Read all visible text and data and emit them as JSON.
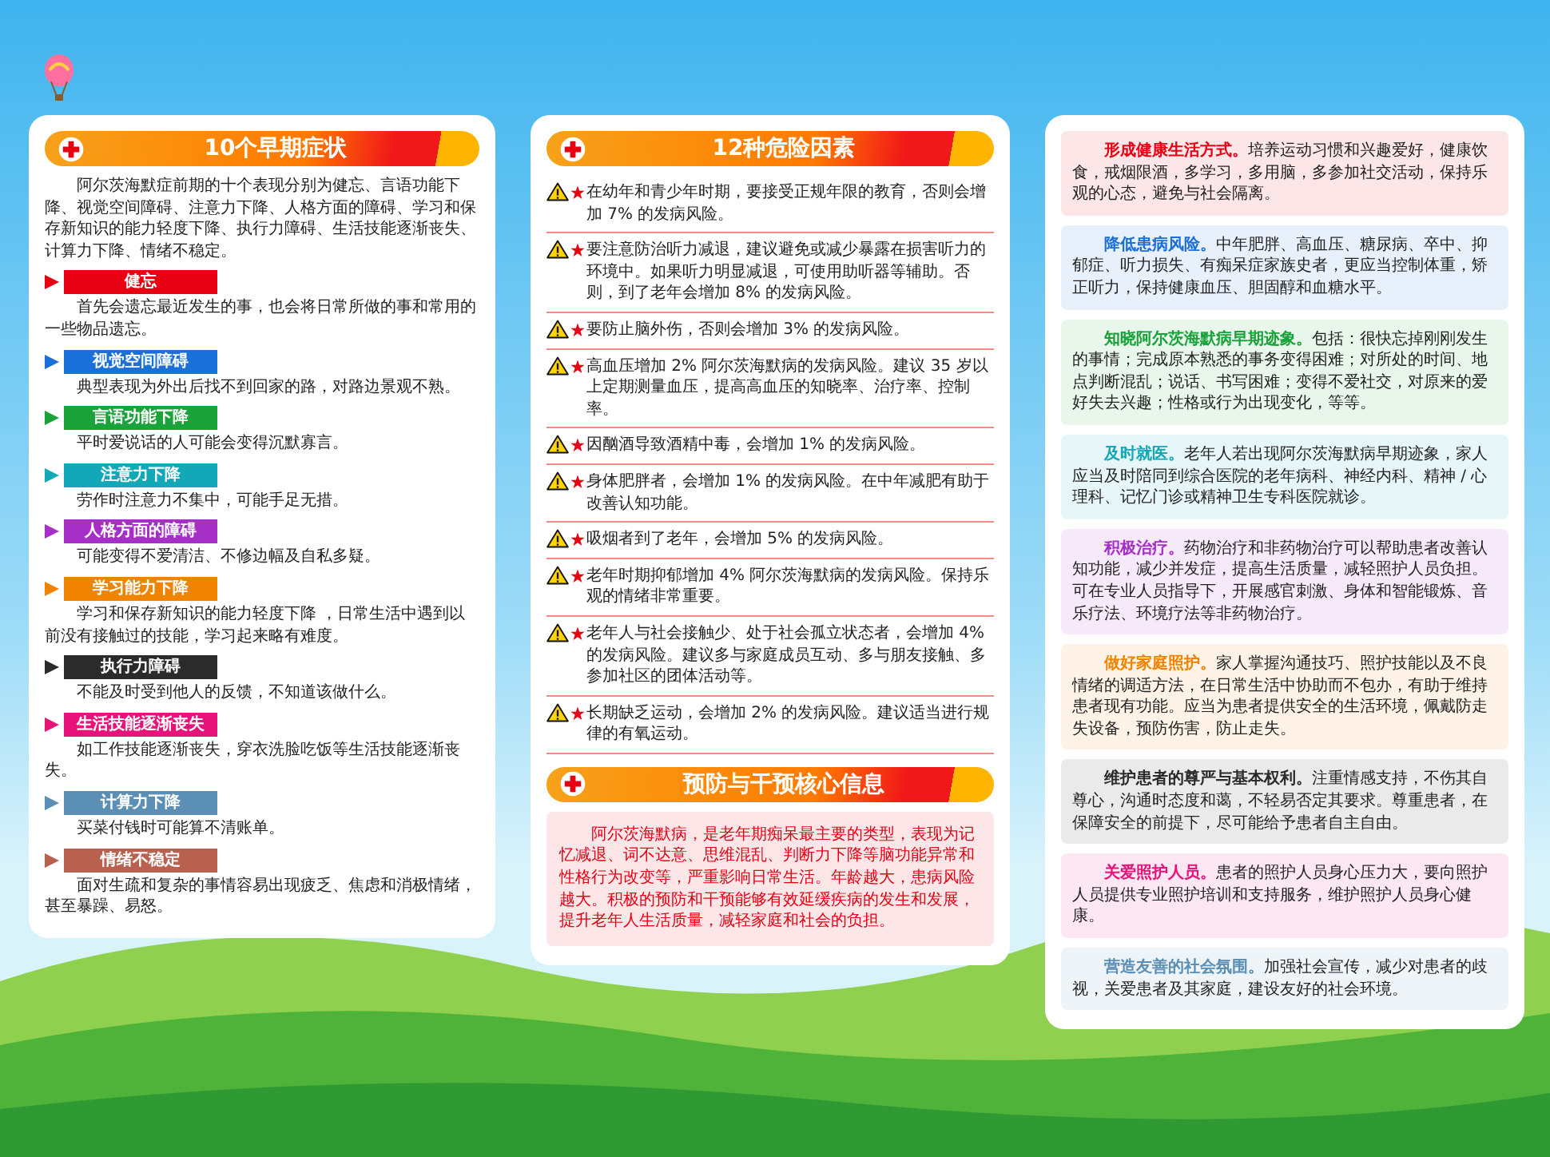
{
  "symptoms": {
    "title": "10个早期症状",
    "intro": "阿尔茨海默症前期的十个表现分别为健忘、言语功能下降、视觉空间障碍、注意力下降、人格方面的障碍、学习和保存新知识的能力轻度下降、执行力障碍、生活技能逐渐丧失、计算力下降、情绪不稳定。",
    "items": [
      {
        "label": "健忘",
        "color": "#e60012",
        "text": "首先会遗忘最近发生的事，也会将日常所做的事和常用的一些物品遗忘。"
      },
      {
        "label": "视觉空间障碍",
        "color": "#1a6fd8",
        "text": "典型表现为外出后找不到回家的路，对路边景观不熟。"
      },
      {
        "label": "言语功能下降",
        "color": "#1aa33a",
        "text": "平时爱说话的人可能会变得沉默寡言。"
      },
      {
        "label": "注意力下降",
        "color": "#12a8b8",
        "text": "劳作时注意力不集中，可能手足无措。"
      },
      {
        "label": "人格方面的障碍",
        "color": "#a62fc8",
        "text": "可能变得不爱清洁、不修边幅及自私多疑。"
      },
      {
        "label": "学习能力下降",
        "color": "#f08300",
        "text": "学习和保存新知识的能力轻度下降 ，日常生活中遇到以前没有接触过的技能，学习起来略有难度。"
      },
      {
        "label": "执行力障碍",
        "color": "#2b2b2b",
        "text": "不能及时受到他人的反馈，不知道该做什么。"
      },
      {
        "label": "生活技能逐渐丧失",
        "color": "#e8137a",
        "text": "如工作技能逐渐丧失，穿衣洗脸吃饭等生活技能逐渐丧失。"
      },
      {
        "label": "计算力下降",
        "color": "#5b8fb5",
        "text": "买菜付钱时可能算不清账单。"
      },
      {
        "label": "情绪不稳定",
        "color": "#b8614e",
        "text": "面对生疏和复杂的事情容易出现疲乏、焦虑和消极情绪，甚至暴躁、易怒。"
      }
    ]
  },
  "risks": {
    "title": "12种危险因素",
    "items": [
      "在幼年和青少年时期，要接受正规年限的教育，否则会增加 7% 的发病风险。",
      "要注意防治听力减退，建议避免或减少暴露在损害听力的环境中。如果听力明显减退，可使用助听器等辅助。否则，到了老年会增加 8% 的发病风险。",
      "要防止脑外伤，否则会增加 3% 的发病风险。",
      "高血压增加 2% 阿尔茨海默病的发病风险。建议 35 岁以上定期测量血压，提高高血压的知晓率、治疗率、控制率。",
      "因酗酒导致酒精中毒，会增加 1% 的发病风险。",
      "身体肥胖者，会增加 1% 的发病风险。在中年减肥有助于改善认知功能。",
      "吸烟者到了老年，会增加 5% 的发病风险。",
      "老年时期抑郁增加 4% 阿尔茨海默病的发病风险。保持乐观的情绪非常重要。",
      "老年人与社会接触少、处于社会孤立状态者，会增加 4% 的发病风险。建议多与家庭成员互动、多与朋友接触、多参加社区的团体活动等。",
      "长期缺乏运动，会增加 2% 的发病风险。建议适当进行规律的有氧运动。"
    ]
  },
  "prevention": {
    "title": "预防与干预核心信息",
    "text": "阿尔茨海默病，是老年期痴呆最主要的类型，表现为记忆减退、词不达意、思维混乱、判断力下降等脑功能异常和性格行为改变等，严重影响日常生活。年龄越大，患病风险越大。积极的预防和干预能够有效延缓疾病的发生和发展，提升老年人生活质量，减轻家庭和社会的负担。"
  },
  "tips": [
    {
      "heading": "形成健康生活方式。",
      "color": "#e60012",
      "text": "培养运动习惯和兴趣爱好，健康饮食，戒烟限酒，多学习，多用脑，多参加社交活动，保持乐观的心态，避免与社会隔离。"
    },
    {
      "heading": "降低患病风险。",
      "color": "#1a6fd8",
      "text": "中年肥胖、高血压、糖尿病、卒中、抑郁症、听力损失、有痴呆症家族史者，更应当控制体重，矫正听力，保持健康血压、胆固醇和血糖水平。"
    },
    {
      "heading": "知晓阿尔茨海默病早期迹象。",
      "color": "#1aa33a",
      "text": "包括：很快忘掉刚刚发生的事情；完成原本熟悉的事务变得困难；对所处的时间、地点判断混乱；说话、书写困难；变得不爱社交，对原来的爱好失去兴趣；性格或行为出现变化，等等。"
    },
    {
      "heading": "及时就医。",
      "color": "#12a8b8",
      "text": "老年人若出现阿尔茨海默病早期迹象，家人应当及时陪同到综合医院的老年病科、神经内科、精神 / 心理科、记忆门诊或精神卫生专科医院就诊。"
    },
    {
      "heading": "积极治疗。",
      "color": "#a62fc8",
      "text": "药物治疗和非药物治疗可以帮助患者改善认知功能，减少并发症，提高生活质量，减轻照护人员负担。可在专业人员指导下，开展感官刺激、身体和智能锻炼、音乐疗法、环境疗法等非药物治疗。"
    },
    {
      "heading": "做好家庭照护。",
      "color": "#f08300",
      "text": "家人掌握沟通技巧、照护技能以及不良情绪的调适方法，在日常生活中协助而不包办，有助于维持患者现有功能。应当为患者提供安全的生活环境，佩戴防走失设备，预防伤害，防止走失。"
    },
    {
      "heading": "维护患者的尊严与基本权利。",
      "color": "#2b2b2b",
      "text": "注重情感支持，不伤其自尊心，沟通时态度和蔼，不轻易否定其要求。尊重患者，在保障安全的前提下，尽可能给予患者自主自由。"
    },
    {
      "heading": "关爱照护人员。",
      "color": "#e8137a",
      "text": "患者的照护人员身心压力大，要向照护人员提供专业照护培训和支持服务，维护照护人员身心健康。"
    },
    {
      "heading": "营造友善的社会氛围。",
      "color": "#5b8fb5",
      "text": "加强社会宣传，减少对患者的歧视，关爱患者及其家庭，建设友好的社会环境。"
    }
  ]
}
